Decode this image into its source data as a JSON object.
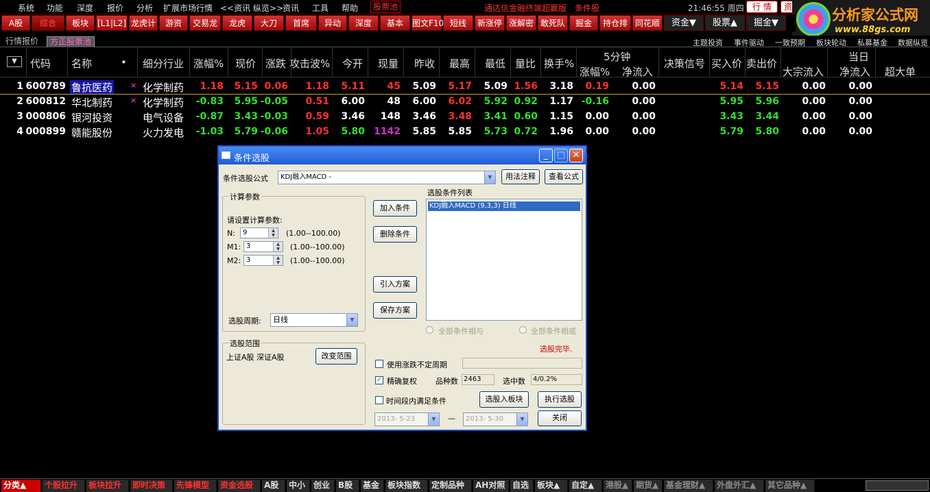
{
  "menu": {
    "items": [
      "系统",
      "功能",
      "深度",
      "报价",
      "分析",
      "扩展市场行情",
      "<<资讯 纵览>>",
      "资讯",
      "工具",
      "帮助"
    ],
    "stock_pool": "股票池",
    "edition": "通达信金融终端超赢版",
    "condition": "条件股",
    "clock": "21:46:55 周四",
    "btn_quote": "行 情",
    "btn_info": "资"
  },
  "logo": {
    "brand": "分析家公式网",
    "url": "www.88gs.com"
  },
  "toolbar": {
    "buttons": [
      "A股",
      "综合",
      "板块",
      "[L1|L2]",
      "龙虎计",
      "游资",
      "交易龙",
      "龙虎",
      "大刀",
      "首席",
      "异动",
      "深度",
      "基本",
      "图文F10",
      "短线",
      "新涨停",
      "涨解密",
      "敢死队",
      "掘金",
      "持仓排",
      "同花顺"
    ],
    "dropdowns": [
      "资金▼",
      "股票▲",
      "掘金▼"
    ]
  },
  "subtabs": {
    "quote": "行情报价",
    "pool": "方正股票池",
    "links": [
      "主题投资",
      "事件驱动",
      "一致预期",
      "板块轮动",
      "私募基金",
      "数据纵览"
    ]
  },
  "columns": {
    "code": "代码",
    "name": "名称",
    "industry": "细分行业",
    "change_pct": "涨幅%",
    "price": "现价",
    "change": "涨跌",
    "attack": "攻击波%",
    "open": "今开",
    "volume": "现量",
    "prev_close": "昨收",
    "high": "最高",
    "low": "最低",
    "vol_ratio": "量比",
    "turnover": "换手%",
    "five_min": "5分钟",
    "five_change": "涨幅%",
    "five_inflow": "净流入",
    "signal": "决策信号",
    "bid": "买入价",
    "ask": "卖出价",
    "today": "当日",
    "block_inflow": "大宗流入",
    "net_inflow": "净流入",
    "super_large": "超大单"
  },
  "stocks": [
    {
      "idx": "1",
      "code": "600789",
      "name": "鲁抗医药",
      "mark": "×",
      "industry": "化学制药",
      "change_pct": "1.18",
      "price": "5.15",
      "change": "0.06",
      "attack": "1.18",
      "open": "5.11",
      "volume": "45",
      "prev_close": "5.09",
      "high": "5.17",
      "low": "5.09",
      "vol_ratio": "1.56",
      "turnover": "3.18",
      "five_change": "0.19",
      "five_inflow": "0.00",
      "bid": "5.14",
      "ask": "5.15",
      "block_inflow": "0.00",
      "net_inflow": "0.00"
    },
    {
      "idx": "2",
      "code": "600812",
      "name": "华北制药",
      "mark": "×",
      "industry": "化学制药",
      "change_pct": "-0.83",
      "price": "5.95",
      "change": "-0.05",
      "attack": "0.51",
      "open": "6.00",
      "volume": "48",
      "prev_close": "6.00",
      "high": "6.02",
      "low": "5.92",
      "vol_ratio": "0.92",
      "turnover": "1.17",
      "five_change": "-0.16",
      "five_inflow": "0.00",
      "bid": "5.95",
      "ask": "5.96",
      "block_inflow": "0.00",
      "net_inflow": "0.00"
    },
    {
      "idx": "3",
      "code": "000806",
      "name": "银河投资",
      "mark": "",
      "industry": "电气设备",
      "change_pct": "-0.87",
      "price": "3.43",
      "change": "-0.03",
      "attack": "0.59",
      "open": "3.46",
      "volume": "148",
      "prev_close": "3.46",
      "high": "3.48",
      "low": "3.41",
      "vol_ratio": "0.60",
      "turnover": "1.15",
      "five_change": "0.00",
      "five_inflow": "0.00",
      "bid": "3.43",
      "ask": "3.44",
      "block_inflow": "0.00",
      "net_inflow": "0.00"
    },
    {
      "idx": "4",
      "code": "000899",
      "name": "赣能股份",
      "mark": "",
      "industry": "火力发电",
      "change_pct": "-1.03",
      "price": "5.79",
      "change": "-0.06",
      "attack": "1.05",
      "open": "5.80",
      "volume": "1142",
      "prev_close": "5.85",
      "high": "5.85",
      "low": "5.73",
      "vol_ratio": "0.72",
      "turnover": "1.96",
      "five_change": "0.00",
      "five_inflow": "0.00",
      "bid": "5.79",
      "ask": "5.80",
      "block_inflow": "0.00",
      "net_inflow": "0.00"
    }
  ],
  "dialog": {
    "title": "条件选股",
    "formula_label": "条件选股公式",
    "formula_value": "KDJ融入MACD -",
    "usage_btn": "用法注释",
    "view_btn": "查看公式",
    "calc_group": "计算参数",
    "set_params": "请设置计算参数:",
    "params": [
      {
        "name": "N:",
        "value": "9",
        "range": "(1.00--100.00)"
      },
      {
        "name": "M1:",
        "value": "3",
        "range": "(1.00--100.00)"
      },
      {
        "name": "M2:",
        "value": "3",
        "range": "(1.00--100.00)"
      }
    ],
    "period_label": "选股周期:",
    "period_value": "日线",
    "add_btn": "加入条件",
    "del_btn": "删除条件",
    "import_btn": "引入方案",
    "save_btn": "保存方案",
    "list_label": "选股条件列表",
    "list_item": "KDJ融入MACD (9,3,3) 日线",
    "radio_and": "全部条件相与",
    "radio_or": "全部条件相或",
    "status": "选股完毕.",
    "scope_group": "选股范围",
    "scope_value": "上证A股 深证A股",
    "change_scope_btn": "改变范围",
    "chk_unfixed": "使用涨跌不定周期",
    "chk_exact": "精确复权",
    "count_label": "品种数",
    "count_value": "2463",
    "selected_label": "选中数",
    "selected_value": "4/0.2%",
    "chk_time": "时间段内满足条件",
    "to_block_btn": "选股入板块",
    "run_btn": "执行选股",
    "date_from": "2013- 5-23",
    "date_sep": "—",
    "date_to": "2013- 5-30",
    "close_btn": "关闭"
  },
  "bottom_tabs": [
    "分类▲",
    "个股拉升",
    "板块拉升",
    "即时决策",
    "先锋模型",
    "资金选股",
    "A股",
    "中小",
    "创业",
    "B股",
    "基金",
    "板块指数",
    "定制品种",
    "AH对照",
    "自选",
    "板块▲",
    "自定▲",
    "港股▲",
    "期货▲",
    "基金理财▲",
    "外盘外汇▲",
    "其它品种▲"
  ]
}
